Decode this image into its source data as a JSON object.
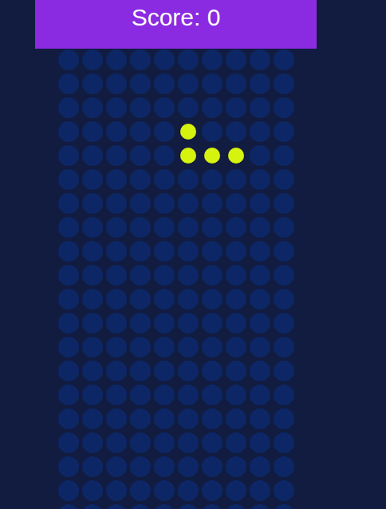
{
  "score": "Score: 0",
  "board": {
    "rows": [
      [
        false,
        false,
        false,
        false,
        false,
        false,
        false,
        false,
        false,
        false
      ],
      [
        false,
        false,
        false,
        false,
        false,
        false,
        false,
        false,
        false,
        false
      ],
      [
        false,
        false,
        false,
        false,
        false,
        false,
        false,
        false,
        false,
        false
      ],
      [
        false,
        false,
        false,
        false,
        false,
        true,
        false,
        false,
        false,
        false
      ],
      [
        false,
        false,
        false,
        false,
        false,
        true,
        true,
        true,
        false,
        false
      ],
      [
        false,
        false,
        false,
        false,
        false,
        false,
        false,
        false,
        false,
        false
      ],
      [
        false,
        false,
        false,
        false,
        false,
        false,
        false,
        false,
        false,
        false
      ],
      [
        false,
        false,
        false,
        false,
        false,
        false,
        false,
        false,
        false,
        false
      ],
      [
        false,
        false,
        false,
        false,
        false,
        false,
        false,
        false,
        false,
        false
      ],
      [
        false,
        false,
        false,
        false,
        false,
        false,
        false,
        false,
        false,
        false
      ],
      [
        false,
        false,
        false,
        false,
        false,
        false,
        false,
        false,
        false,
        false
      ],
      [
        false,
        false,
        false,
        false,
        false,
        false,
        false,
        false,
        false,
        false
      ],
      [
        false,
        false,
        false,
        false,
        false,
        false,
        false,
        false,
        false,
        false
      ],
      [
        false,
        false,
        false,
        false,
        false,
        false,
        false,
        false,
        false,
        false
      ],
      [
        false,
        false,
        false,
        false,
        false,
        false,
        false,
        false,
        false,
        false
      ],
      [
        false,
        false,
        false,
        false,
        false,
        false,
        false,
        false,
        false,
        false
      ],
      [
        false,
        false,
        false,
        false,
        false,
        false,
        false,
        false,
        false,
        false
      ],
      [
        false,
        false,
        false,
        false,
        false,
        false,
        false,
        false,
        false,
        false
      ],
      [
        false,
        false,
        false,
        false,
        false,
        false,
        false,
        false,
        false,
        false
      ],
      [
        false,
        false,
        false,
        false,
        false,
        false,
        false,
        false,
        false,
        false
      ]
    ]
  }
}
